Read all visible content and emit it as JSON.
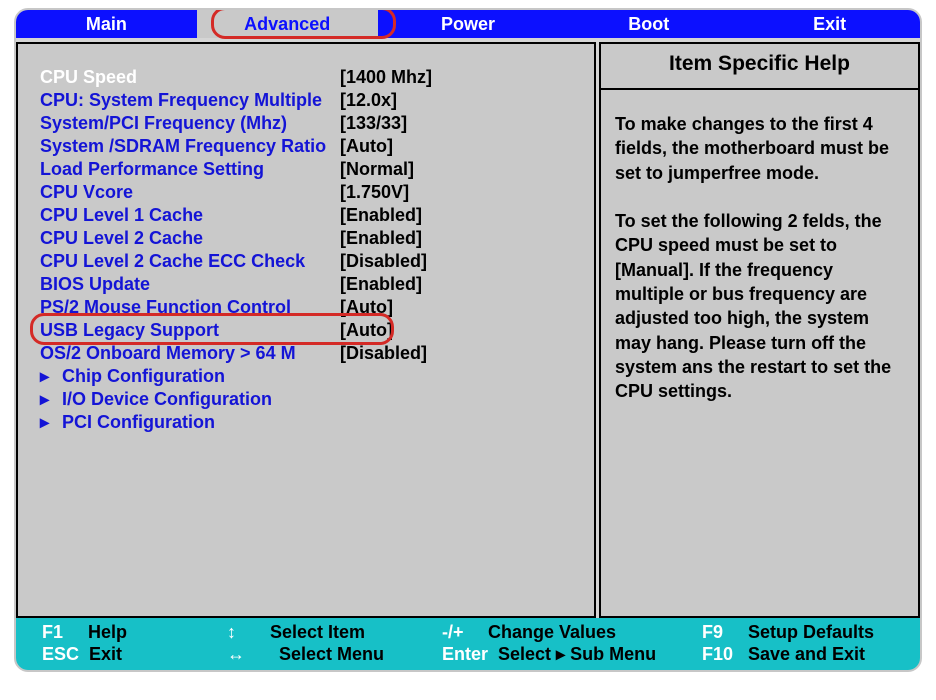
{
  "tabs": [
    "Main",
    "Advanced",
    "Power",
    "Boot",
    "Exit"
  ],
  "active_tab": 1,
  "help": {
    "title": "Item Specific Help",
    "text": "To make changes to the first 4 fields, the motherboard must be set to jumperfree mode.\n\nTo set the following 2 felds, the CPU speed must be set to [Manual]. If the frequency multiple or bus frequency are adjusted too high, the system may hang. Please turn off the system ans the restart to set the CPU settings."
  },
  "items": [
    {
      "label": "CPU Speed",
      "value": "1400 Mhz",
      "white": true
    },
    {
      "label": "CPU: System Frequency Multiple",
      "value": "12.0x"
    },
    {
      "label": "System/PCI Frequency (Mhz)",
      "value": "133/33"
    },
    {
      "label": "System /SDRAM Frequency Ratio",
      "value": "Auto"
    },
    {
      "label": "Load Performance Setting",
      "value": "Normal"
    },
    {
      "label": "CPU Vcore",
      "value": "1.750V"
    },
    {
      "label": "CPU Level 1 Cache",
      "value": "Enabled"
    },
    {
      "label": "CPU Level 2 Cache",
      "value": "Enabled"
    },
    {
      "label": "CPU Level 2 Cache ECC Check",
      "value": "Disabled"
    },
    {
      "label": "BIOS Update",
      "value": "Enabled"
    },
    {
      "label": "PS/2 Mouse Function Control",
      "value": "Auto"
    },
    {
      "label": "USB Legacy Support",
      "value": "Auto",
      "highlight": true
    },
    {
      "label": "OS/2 Onboard Memory > 64 M",
      "value": "Disabled"
    },
    {
      "label": "Chip Configuration",
      "sub": true
    },
    {
      "label": "I/O Device Configuration",
      "sub": true
    },
    {
      "label": "PCI Configuration",
      "sub": true
    }
  ],
  "footer": {
    "f1": {
      "key": "F1",
      "act": "Help"
    },
    "esc": {
      "key": "ESC",
      "act": "Exit"
    },
    "updown": {
      "glyph": "↕",
      "act": "Select Item"
    },
    "leftright": {
      "glyph": "↔",
      "act": "Select Menu"
    },
    "pm": {
      "key": "-/+",
      "act": "Change Values"
    },
    "enter": {
      "key": "Enter",
      "act": "Select ▸ Sub Menu"
    },
    "f9": {
      "key": "F9",
      "act": "Setup Defaults"
    },
    "f10": {
      "key": "F10",
      "act": "Save and Exit"
    }
  }
}
